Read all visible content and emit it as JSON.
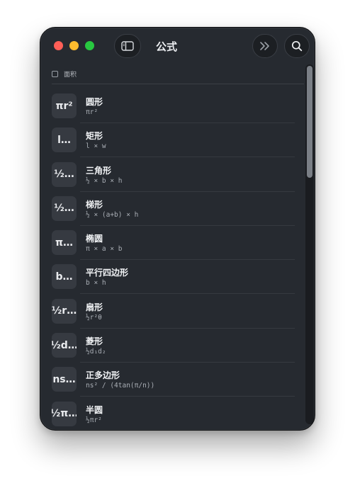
{
  "window": {
    "title": "公式"
  },
  "filter": {
    "label": "面积"
  },
  "icons": {
    "sidebar": "sidebar-toggle-icon",
    "more": "chevron-double-right-icon",
    "search": "search-icon"
  },
  "colors": {
    "close": "#ff5f57",
    "minimize": "#febc2e",
    "maximize": "#28c840",
    "window_bg": "#262a30",
    "badge_bg": "#363a41"
  },
  "items": [
    {
      "badge": "πr²",
      "name": "圆形",
      "formula": "πr²"
    },
    {
      "badge": "l…",
      "name": "矩形",
      "formula": "l × w"
    },
    {
      "badge": "½…",
      "name": "三角形",
      "formula": "½ × b × h"
    },
    {
      "badge": "½…",
      "name": "梯形",
      "formula": "½ × (a+b) × h"
    },
    {
      "badge": "π…",
      "name": "椭圆",
      "formula": "π × a × b"
    },
    {
      "badge": "b…",
      "name": "平行四边形",
      "formula": "b × h"
    },
    {
      "badge": "½r…",
      "name": "扇形",
      "formula": "½r²θ"
    },
    {
      "badge": "½d…",
      "name": "菱形",
      "formula": "½d₁d₂"
    },
    {
      "badge": "ns…",
      "name": "正多边形",
      "formula": "ns² / (4tan(π/n))"
    },
    {
      "badge": "½π…",
      "name": "半圆",
      "formula": "½πr²"
    }
  ]
}
